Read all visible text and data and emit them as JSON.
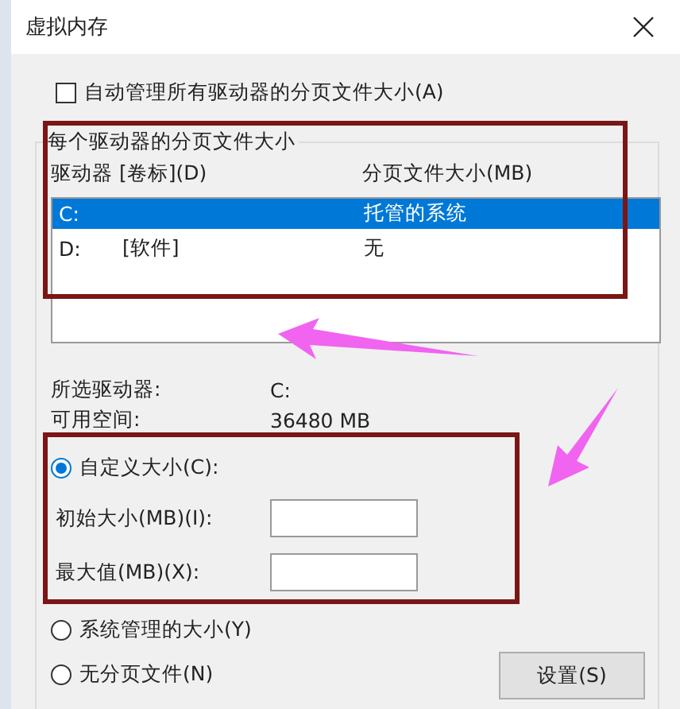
{
  "window": {
    "title": "虚拟内存"
  },
  "auto_manage": {
    "label": "自动管理所有驱动器的分页文件大小(A)",
    "checked": false
  },
  "group": {
    "title": "每个驱动器的分页文件大小",
    "columns": [
      "驱动器 [卷标](D)",
      "分页文件大小(MB)"
    ],
    "rows": [
      {
        "drive": "C:",
        "size": "托管的系统",
        "selected": true
      },
      {
        "drive": "D:",
        "volume": "[软件]",
        "size": "无",
        "selected": false
      }
    ],
    "info": [
      {
        "label": "所选驱动器:",
        "value": "C:"
      },
      {
        "label": "可用空间:",
        "value": "36480 MB"
      }
    ],
    "size_options": [
      {
        "label": "自定义大小(C):",
        "selected": true
      },
      {
        "label": "系统管理的大小(Y)",
        "selected": false
      },
      {
        "label": "无分页文件(N)",
        "selected": false
      }
    ],
    "fields": [
      {
        "label": "初始大小(MB)(I):"
      },
      {
        "label": "最大值(MB)(X):"
      }
    ],
    "set_button": "设置(S)"
  },
  "annotations": [
    {
      "kind": "frame",
      "color": "#7a1616"
    },
    {
      "kind": "frame",
      "color": "#7a1616"
    },
    {
      "kind": "arrow",
      "color": "#f064f0"
    },
    {
      "kind": "arrow",
      "color": "#f064f0"
    }
  ]
}
